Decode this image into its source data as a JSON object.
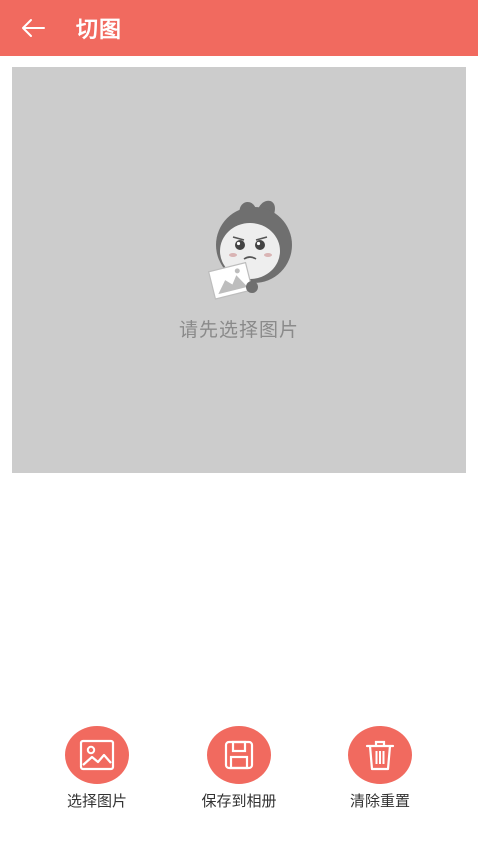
{
  "colors": {
    "accent": "#f16a5f",
    "preview_bg": "#cccccc",
    "placeholder_text": "#8a8a8a"
  },
  "header": {
    "back_icon": "arrow-left-icon",
    "title": "切图"
  },
  "preview": {
    "placeholder_icon": "mascot-holding-picture-icon",
    "placeholder_text": "请先选择图片"
  },
  "actions": [
    {
      "icon": "image-icon",
      "label": "选择图片"
    },
    {
      "icon": "save-icon",
      "label": "保存到相册"
    },
    {
      "icon": "trash-icon",
      "label": "清除重置"
    }
  ]
}
